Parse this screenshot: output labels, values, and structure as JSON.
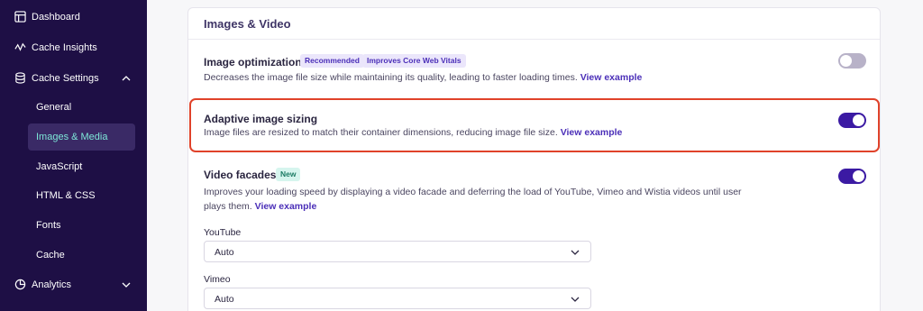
{
  "sidebar": {
    "items": [
      {
        "label": "Dashboard",
        "icon": "dashboard-icon"
      },
      {
        "label": "Cache Insights",
        "icon": "insights-icon"
      },
      {
        "label": "Cache Settings",
        "icon": "database-icon",
        "expanded": true
      },
      {
        "label": "Analytics",
        "icon": "analytics-icon",
        "expanded": false
      }
    ],
    "subitems": [
      {
        "label": "General"
      },
      {
        "label": "Images & Media",
        "active": true
      },
      {
        "label": "JavaScript"
      },
      {
        "label": "HTML & CSS"
      },
      {
        "label": "Fonts"
      },
      {
        "label": "Cache"
      }
    ]
  },
  "card": {
    "title": "Images & Video"
  },
  "settings": {
    "image_optimization": {
      "title": "Image optimization",
      "badge1": "Recommended",
      "badge2": "Improves Core Web Vitals",
      "desc": "Decreases the image file size while maintaining its quality, leading to faster loading times.",
      "link": "View example",
      "enabled": false
    },
    "adaptive_sizing": {
      "title": "Adaptive image sizing",
      "desc": "Image files are resized to match their container dimensions, reducing image file size.",
      "link": "View example",
      "enabled": true
    },
    "video_facades": {
      "title": "Video facades",
      "badge": "New",
      "desc_line1": "Improves your loading speed by displaying a video facade and deferring the load of YouTube, Vimeo and Wistia videos until user plays",
      "desc_line2": "them.",
      "link": "View example",
      "enabled": true
    }
  },
  "fields": {
    "youtube": {
      "label": "YouTube",
      "value": "Auto"
    },
    "vimeo": {
      "label": "Vimeo",
      "value": "Auto"
    }
  },
  "colors": {
    "sidebar_bg": "#1e0f45",
    "accent": "#3b1aa3",
    "active_text": "#7ee8d8",
    "highlight": "#e0422a"
  }
}
